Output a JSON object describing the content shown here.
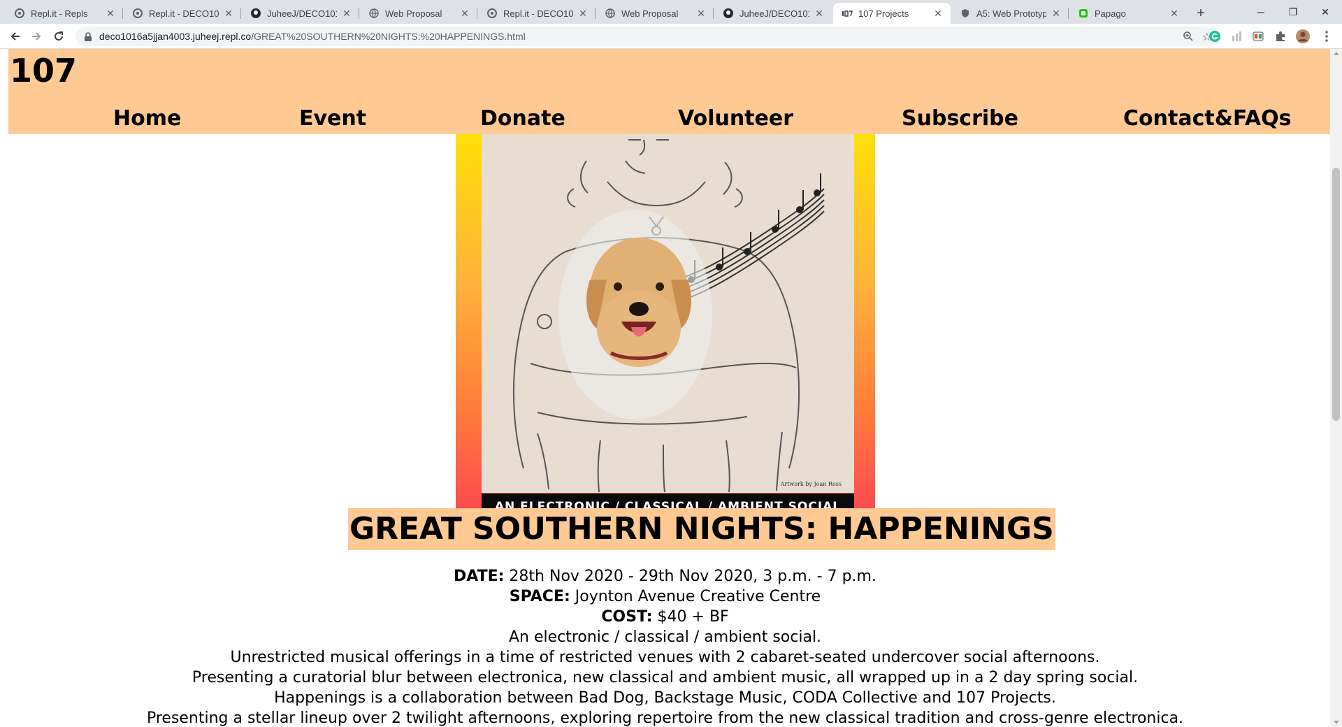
{
  "browser": {
    "tabs": [
      {
        "title": "Repl.it - Repls",
        "icon": "replit-icon"
      },
      {
        "title": "Repl.it - DECO1016",
        "icon": "replit-icon"
      },
      {
        "title": "JuheeJ/DECO1016_",
        "icon": "github-icon"
      },
      {
        "title": "Web Proposal",
        "icon": "globe-icon"
      },
      {
        "title": "Repl.it - DECO1016",
        "icon": "replit-icon"
      },
      {
        "title": "Web Proposal",
        "icon": "globe-icon"
      },
      {
        "title": "JuheeJ/DECO1016_",
        "icon": "github-icon"
      },
      {
        "title": "107 Projects",
        "icon": "site-107-icon"
      },
      {
        "title": "A5: Web Prototype",
        "icon": "shield-icon"
      },
      {
        "title": "Papago",
        "icon": "papago-icon"
      }
    ],
    "active_tab": 7,
    "url_host": "deco1016a5jjan4003.juheej.repl.co",
    "url_path": "/GREAT%20SOUTHERN%20NIGHTS:%20HAPPENINGS.html"
  },
  "site": {
    "logo": "107",
    "nav": [
      "Home",
      "Event",
      "Donate",
      "Volunteer",
      "Subscribe",
      "Contact&FAQs"
    ],
    "header_color": "#ffc994"
  },
  "poster": {
    "band_text": "AN ELECTRONIC / CLASSICAL / AMBIENT SOCIAL",
    "credit": "Artwork by Joan Ross"
  },
  "event": {
    "title": "GREAT SOUTHERN NIGHTS: HAPPENINGS",
    "date_label": "DATE:",
    "date_value": " 28th Nov 2020 - 29th Nov 2020, 3 p.m. - 7 p.m.",
    "space_label": "SPACE:",
    "space_value": " Joynton Avenue Creative Centre",
    "cost_label": "COST:",
    "cost_value": " $40 + BF",
    "description": [
      "An electronic / classical / ambient social.",
      "Unrestricted musical offerings in a time of restricted venues with 2 cabaret-seated undercover social afternoons.",
      "Presenting a curatorial blur between electronica, new classical and ambient music, all wrapped up in a 2 day spring social.",
      "Happenings is a collaboration between Bad Dog, Backstage Music, CODA Collective and 107 Projects.",
      "Presenting a stellar lineup over 2 twilight afternoons, exploring repertoire from the new classical tradition and cross-genre electronica."
    ]
  }
}
